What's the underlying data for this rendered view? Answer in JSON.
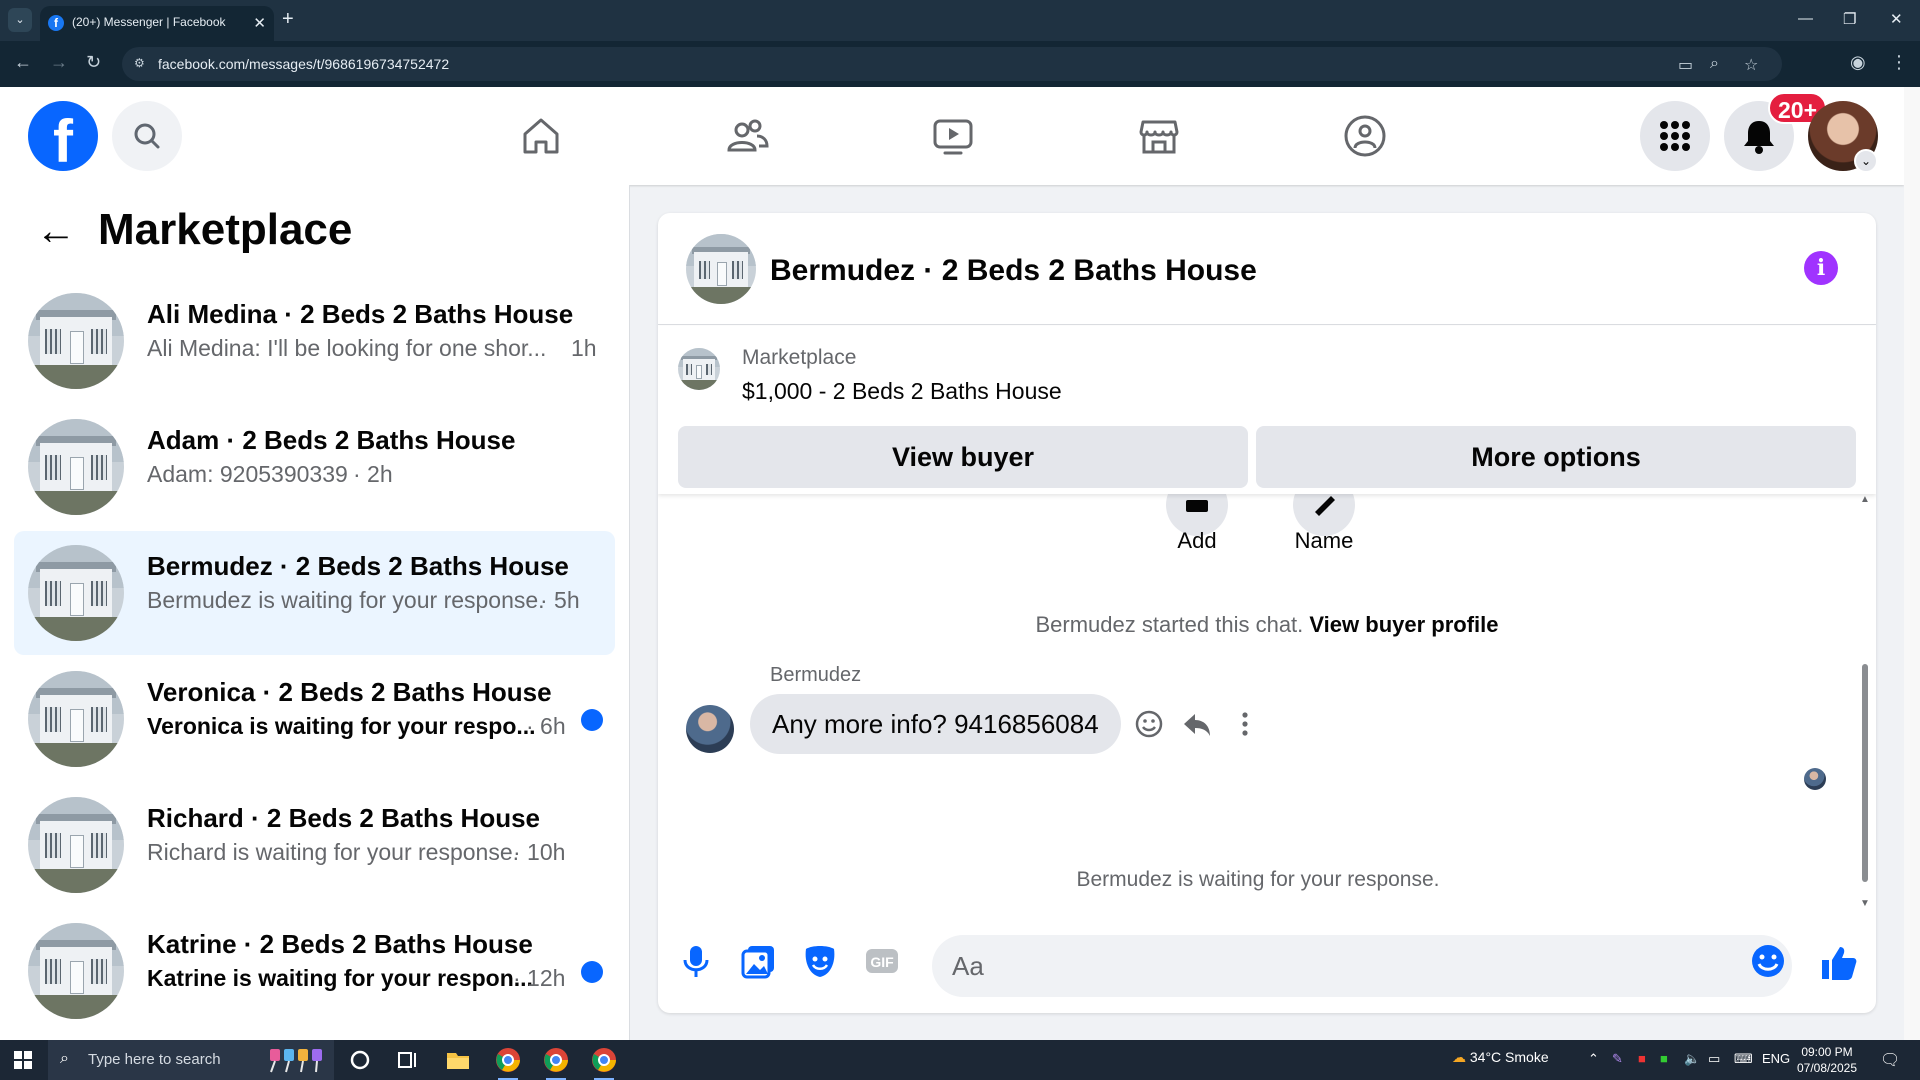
{
  "browser": {
    "tab_title": "(20+) Messenger | Facebook",
    "url": "facebook.com/messages/t/9686196734752472"
  },
  "fbnav": {
    "notification_badge": "20+"
  },
  "left_panel": {
    "title": "Marketplace",
    "conversations": [
      {
        "name": "Ali Medina · 2 Beds 2 Baths House",
        "preview": "Ali Medina: I'll be looking for one shor...",
        "time": "1h",
        "unread": false,
        "active": false
      },
      {
        "name": "Adam · 2 Beds 2 Baths House",
        "preview": "Adam: 9205390339",
        "time": "· 2h",
        "unread": false,
        "active": false
      },
      {
        "name": "Bermudez · 2 Beds 2 Baths House",
        "preview": "Bermudez is waiting for your response.",
        "time": "· 5h",
        "unread": false,
        "active": true
      },
      {
        "name": "Veronica · 2 Beds 2 Baths House",
        "preview": "Veronica is waiting for your respo...",
        "time": "· 6h",
        "unread": true,
        "active": false
      },
      {
        "name": "Richard · 2 Beds 2 Baths House",
        "preview": "Richard is waiting for your response.",
        "time": "· 10h",
        "unread": false,
        "active": false
      },
      {
        "name": "Katrine · 2 Beds 2 Baths House",
        "preview": "Katrine is waiting for your respon...",
        "time": "· 12h",
        "unread": true,
        "active": false
      }
    ]
  },
  "chat": {
    "title": "Bermudez · 2 Beds 2 Baths House",
    "marketplace_label": "Marketplace",
    "listing": "$1,000 - 2 Beds 2 Baths House",
    "view_buyer": "View buyer",
    "more_options": "More options",
    "action_add": "Add",
    "action_name": "Name",
    "started_text": "Bermudez started this chat.",
    "view_buyer_profile": "View buyer profile",
    "sender": "Bermudez",
    "message": "Any more info? 9416856084",
    "waiting": "Bermudez is waiting for your response.",
    "input_placeholder": "Aa"
  },
  "taskbar": {
    "search_placeholder": "Type here to search",
    "weather": "34°C  Smoke",
    "language": "ENG",
    "time": "09:00 PM",
    "date": "07/08/2025"
  },
  "colors": {
    "fb_blue": "#0866ff",
    "active_row": "#ebf5ff",
    "info_purple": "#a033ff",
    "badge_red": "#e41e3f"
  }
}
